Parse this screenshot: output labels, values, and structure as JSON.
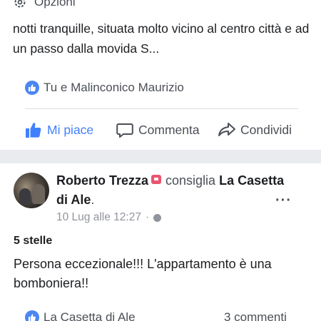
{
  "post_top": {
    "options_label": "Opzioni",
    "text": "notti tranquille, situata molto vicino al centro città e ad un passo dalla movida S...",
    "reactions_label": "Tu e Malinconico Maurizio"
  },
  "actions": {
    "like": "Mi piace",
    "comment": "Commenta",
    "share": "Condividi"
  },
  "post2": {
    "author": "Roberto Trezza",
    "verb": "consiglia",
    "page": "La Casetta di Ale",
    "date": "10 Lug alle 12:27",
    "dot": "·",
    "more": "···",
    "rating": "5 stelle",
    "review": "Persona eccezionale!!! L'appartamento è una bomboniera!!",
    "reactions_label": "La Casetta di Ale",
    "comments_count": "3 commenti"
  },
  "colors": {
    "facebook_blue": "#4080ff",
    "separator": "#e9ebee",
    "muted_text": "#90949c"
  }
}
